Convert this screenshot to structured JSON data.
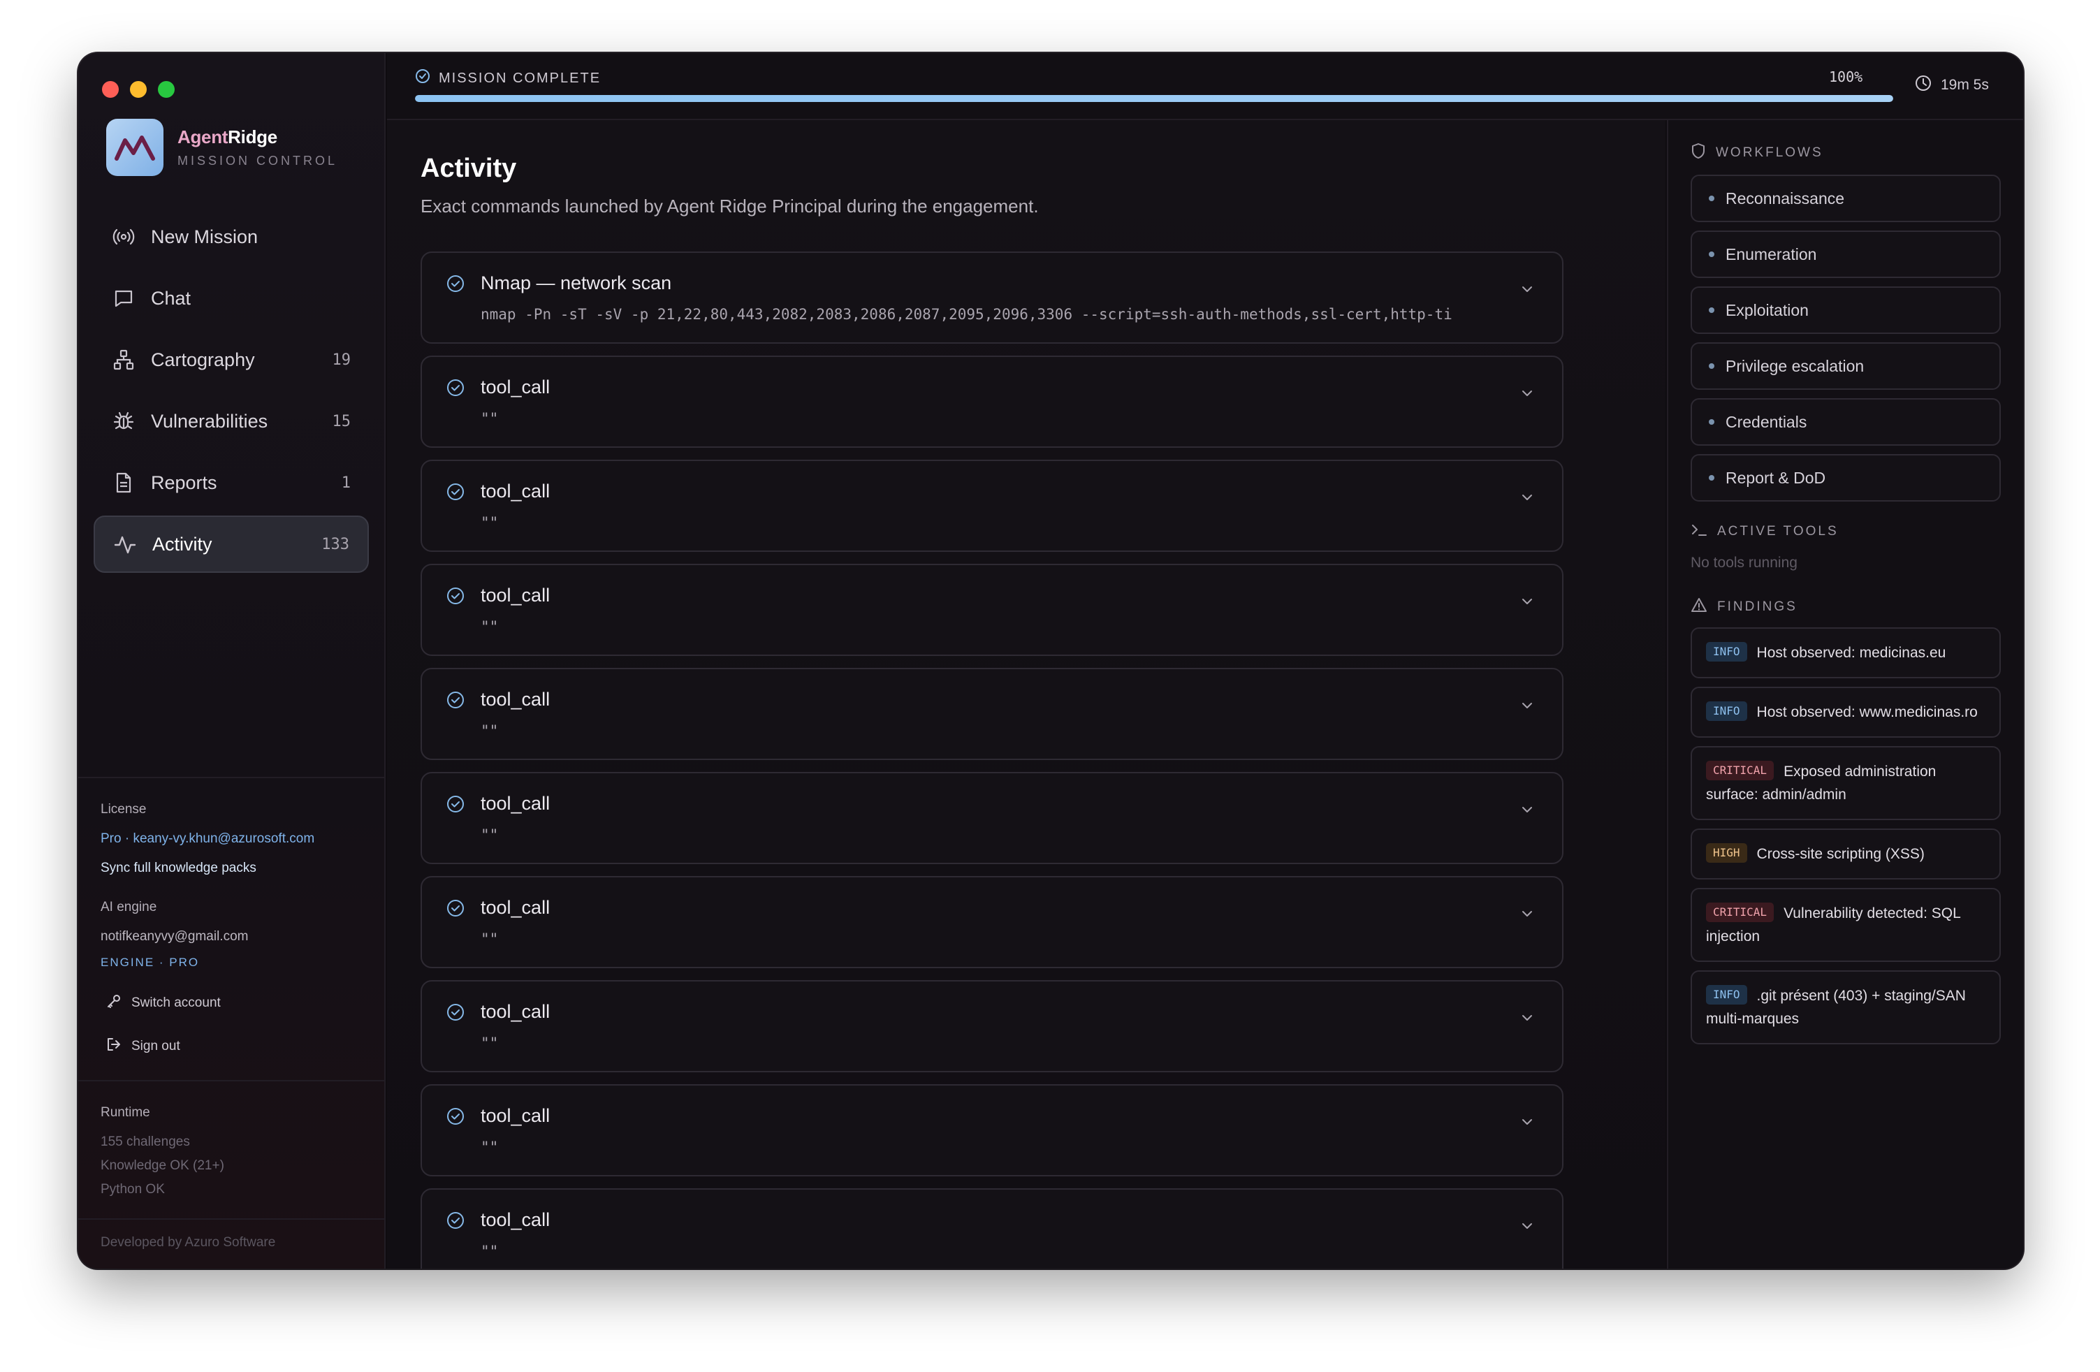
{
  "app": {
    "brand_part1": "Agent",
    "brand_part2": "Ridge",
    "brand_sub": "MISSION CONTROL"
  },
  "nav": [
    {
      "label": "New Mission",
      "count": "",
      "icon": "broadcast-icon"
    },
    {
      "label": "Chat",
      "count": "",
      "icon": "chat-icon"
    },
    {
      "label": "Cartography",
      "count": "19",
      "icon": "network-icon"
    },
    {
      "label": "Vulnerabilities",
      "count": "15",
      "icon": "bug-icon"
    },
    {
      "label": "Reports",
      "count": "1",
      "icon": "document-icon"
    },
    {
      "label": "Activity",
      "count": "133",
      "icon": "activity-icon",
      "active": true
    }
  ],
  "sidebar_bottom": {
    "license_label": "License",
    "license_value": "Pro · keany-vy.khun@azurosoft.com",
    "sync_link": "Sync full knowledge packs",
    "ai_label": "AI engine",
    "ai_email": "notifkeanyvy@gmail.com",
    "engine_tag": "ENGINE · PRO",
    "switch_account": "Switch account",
    "sign_out": "Sign out",
    "runtime_label": "Runtime",
    "runtime_lines": [
      "155 challenges",
      "Knowledge OK (21+)",
      "Python OK"
    ],
    "footer": "Developed by Azuro Software"
  },
  "topbar": {
    "status": "MISSION COMPLETE",
    "percent": "100%",
    "progress": 1.0,
    "elapsed": "19m 5s"
  },
  "main": {
    "title": "Activity",
    "subtitle": "Exact commands launched by Agent Ridge Principal during the engagement.",
    "items": [
      {
        "title": "Nmap — network scan",
        "cmd": "nmap -Pn -sT -sV -p 21,22,80,443,2082,2083,2086,2087,2095,2096,3306 --script=ssh-auth-methods,ssl-cert,http-ti"
      },
      {
        "title": "tool_call",
        "cmd": "\"\""
      },
      {
        "title": "tool_call",
        "cmd": "\"\""
      },
      {
        "title": "tool_call",
        "cmd": "\"\""
      },
      {
        "title": "tool_call",
        "cmd": "\"\""
      },
      {
        "title": "tool_call",
        "cmd": "\"\""
      },
      {
        "title": "tool_call",
        "cmd": "\"\""
      },
      {
        "title": "tool_call",
        "cmd": "\"\""
      },
      {
        "title": "tool_call",
        "cmd": "\"\""
      },
      {
        "title": "tool_call",
        "cmd": "\"\""
      }
    ]
  },
  "right": {
    "workflows_head": "WORKFLOWS",
    "workflows": [
      "Reconnaissance",
      "Enumeration",
      "Exploitation",
      "Privilege escalation",
      "Credentials",
      "Report & DoD"
    ],
    "tools_head": "ACTIVE TOOLS",
    "tools_empty": "No tools running",
    "findings_head": "FINDINGS",
    "findings": [
      {
        "severity": "INFO",
        "text": "Host observed: medicinas.eu"
      },
      {
        "severity": "INFO",
        "text": "Host observed: www.medicinas.ro"
      },
      {
        "severity": "CRITICAL",
        "text": "Exposed administration surface: admin/admin"
      },
      {
        "severity": "HIGH",
        "text": "Cross-site scripting (XSS)"
      },
      {
        "severity": "CRITICAL",
        "text": "Vulnerability detected: SQL injection"
      },
      {
        "severity": "INFO",
        "text": ".git présent (403) + staging/SAN multi-marques"
      }
    ]
  },
  "colors": {
    "accent": "#8cc3f2",
    "critical": "#f1a3ac",
    "high": "#f0c48c",
    "info": "#8ec0ee"
  }
}
